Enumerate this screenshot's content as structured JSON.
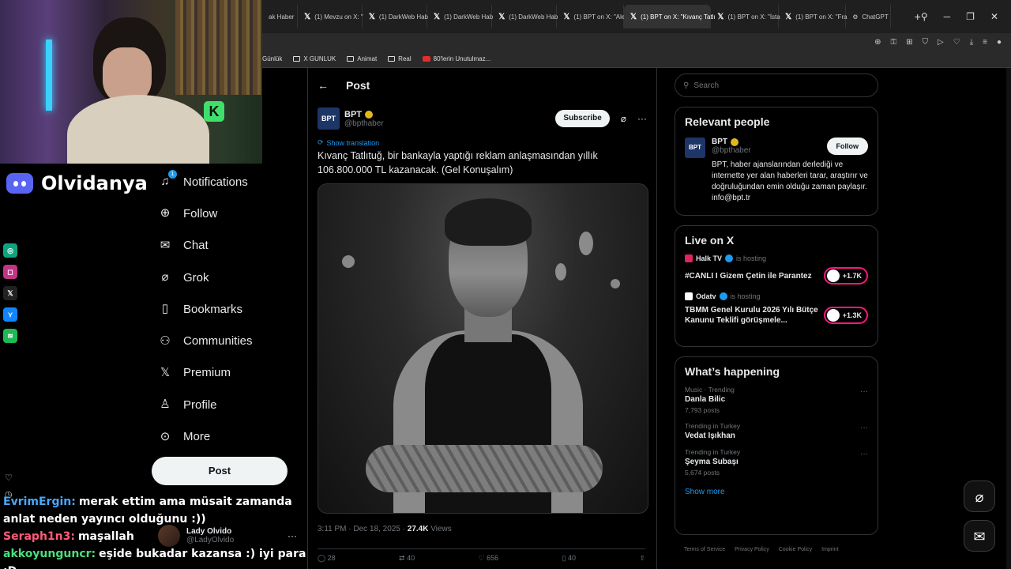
{
  "browser": {
    "tabs": [
      {
        "label": "ak Haber",
        "active": false
      },
      {
        "label": "(1) Mevzu on X: \"",
        "active": false
      },
      {
        "label": "(1) DarkWeb Hab",
        "active": false
      },
      {
        "label": "(1) DarkWeb Hab",
        "active": false
      },
      {
        "label": "(1) DarkWeb Hab",
        "active": false
      },
      {
        "label": "(1) BPT on X: \"Ale",
        "active": false
      },
      {
        "label": "(1) BPT on X: \"Kıvanç Tatlı",
        "active": true
      },
      {
        "label": "(1) BPT on X: \"İsta",
        "active": false
      },
      {
        "label": "(1) BPT on X: \"Fra",
        "active": false
      },
      {
        "label": "ChatGPT",
        "active": false
      }
    ],
    "bookmarks": [
      "Günlük",
      "X GUNLUK",
      "Animat",
      "Real",
      "80'lerin Unutulmaz..."
    ]
  },
  "overlay": {
    "streamer_name": "Olvidanya",
    "chat": [
      {
        "user": "EvrimErgin:",
        "message": "merak ettim ama müsait zamanda anlat neden yayıncı olduğunu :))",
        "color": "#4aa8ff"
      },
      {
        "user": "Seraph1n3:",
        "message": "maşallah",
        "color": "#ff5a7a"
      },
      {
        "user": "akkoyunguncr:",
        "message": "eşide bukadar kazansa :) iyi para :D",
        "color": "#4be07a"
      }
    ]
  },
  "nav": {
    "items": [
      {
        "label": "Notifications",
        "icon": "bell-icon",
        "glyph": "🔔︎"
      },
      {
        "label": "Follow",
        "icon": "person-add-icon",
        "glyph": "⊕"
      },
      {
        "label": "Chat",
        "icon": "mail-icon",
        "glyph": "✉"
      },
      {
        "label": "Grok",
        "icon": "grok-icon",
        "glyph": "⌀"
      },
      {
        "label": "Bookmarks",
        "icon": "bookmark-icon",
        "glyph": "▯"
      },
      {
        "label": "Communities",
        "icon": "people-icon",
        "glyph": "⚇"
      },
      {
        "label": "Premium",
        "icon": "x-logo-icon",
        "glyph": "𝕏"
      },
      {
        "label": "Profile",
        "icon": "person-icon",
        "glyph": "⚲"
      },
      {
        "label": "More",
        "icon": "more-circle-icon",
        "glyph": "⊙"
      }
    ],
    "notification_badge": "1",
    "post_button": "Post",
    "account": {
      "name": "Lady Olvido",
      "handle": "@LadyOlvido"
    }
  },
  "post": {
    "header": "Post",
    "author_name": "BPT",
    "author_handle": "@bpthaber",
    "avatar_text": "BPT",
    "subscribe": "Subscribe",
    "translate": "Show translation",
    "text": "Kıvanç Tatlıtuğ, bir bankayla yaptığı reklam anlaşmasından yıllık 106.800.000 TL kazanacak. (Gel Konuşalım)",
    "timestamp": "3:11 PM · Dec 18, 2025 · ",
    "views_count": "27.4K",
    "views_label": " Views",
    "actions": [
      "28",
      "40",
      "656",
      "40"
    ]
  },
  "sidebar": {
    "search_placeholder": "Search",
    "relevant_title": "Relevant people",
    "relevant": {
      "name": "BPT",
      "handle": "@bpthaber",
      "follow": "Follow",
      "bio": "BPT, haber ajanslarından derlediği ve internette yer alan haberleri tarar, araştırır ve doğruluğundan emin olduğu zaman paylaşır. info@bpt.tr"
    },
    "live_title": "Live on X",
    "live": [
      {
        "host": "Halk TV",
        "hosting": "is hosting",
        "title": "#CANLI I Gizem Çetin ile Parantez",
        "count": "+1.7K",
        "color": "#e0245e"
      },
      {
        "host": "Odatv",
        "hosting": "is hosting",
        "title": "TBMM Genel Kurulu 2026 Yılı Bütçe Kanunu Teklifi görüşmele...",
        "count": "+1.3K",
        "color": "#e0245e"
      }
    ],
    "happening_title": "What’s happening",
    "trends": [
      {
        "category": "Music · Trending",
        "name": "Danla Bilic",
        "count": "7,793 posts"
      },
      {
        "category": "Trending in Turkey",
        "name": "Vedat Işıkhan",
        "count": ""
      },
      {
        "category": "Trending in Turkey",
        "name": "Şeyma Subaşı",
        "count": "5,674 posts"
      }
    ],
    "show_more": "Show more",
    "footer": [
      "Terms of Service",
      "Privacy Policy",
      "Cookie Policy",
      "Imprint"
    ]
  }
}
